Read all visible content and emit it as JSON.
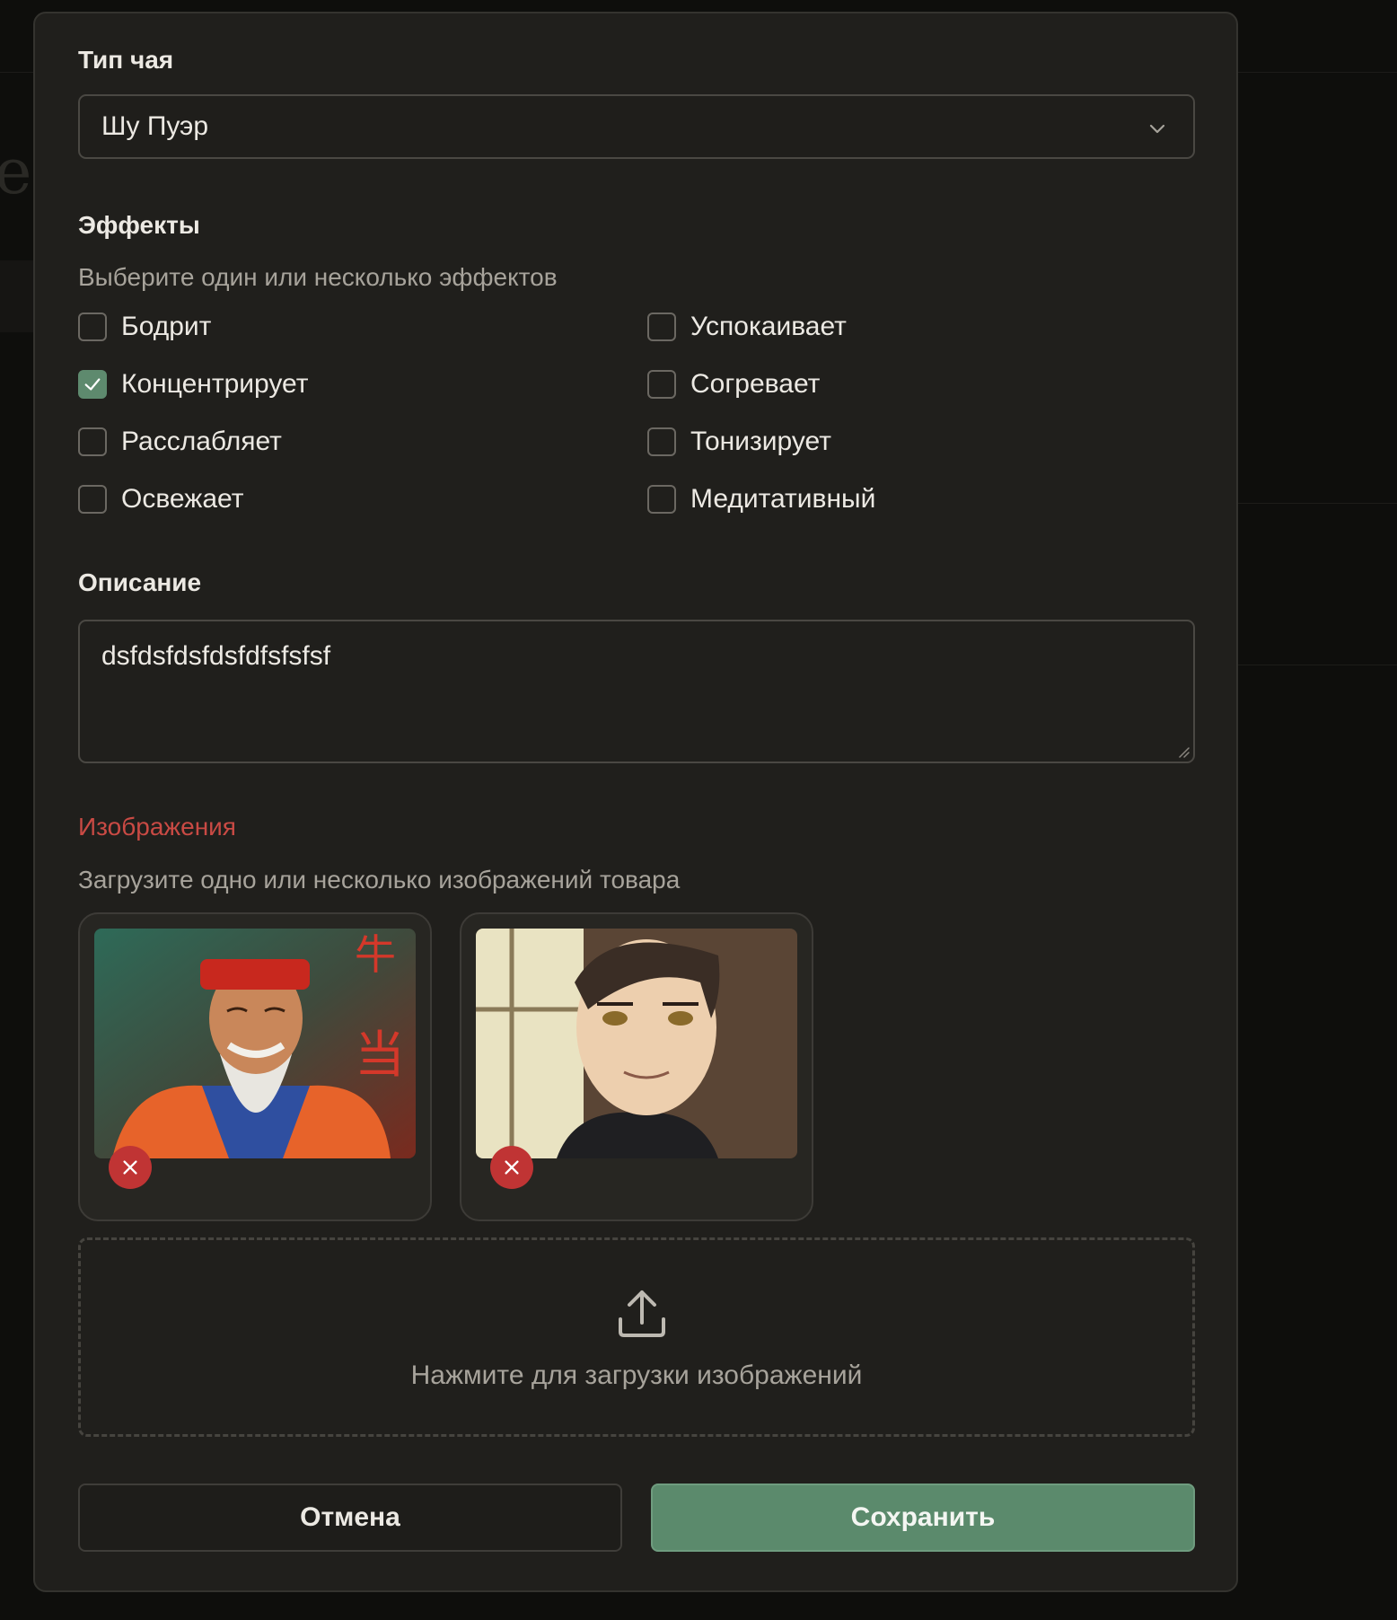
{
  "form": {
    "tea_type": {
      "label": "Тип чая",
      "selected": "Шу Пуэр"
    },
    "effects": {
      "label": "Эффекты",
      "hint": "Выберите один или несколько эффектов",
      "options": [
        {
          "label": "Бодрит",
          "checked": false
        },
        {
          "label": "Успокаивает",
          "checked": false
        },
        {
          "label": "Концентрирует",
          "checked": true
        },
        {
          "label": "Согревает",
          "checked": false
        },
        {
          "label": "Расслабляет",
          "checked": false
        },
        {
          "label": "Тонизирует",
          "checked": false
        },
        {
          "label": "Освежает",
          "checked": false
        },
        {
          "label": "Медитативный",
          "checked": false
        }
      ]
    },
    "description": {
      "label": "Описание",
      "value": "dsfdsfdsfdsfdfsfsfsf"
    },
    "images": {
      "label": "Изображения",
      "hint": "Загрузите одно или несколько изображений товара",
      "items": [
        {
          "subject": "elderly man with white beard and red hat"
        },
        {
          "subject": "anime-style young man portrait"
        }
      ],
      "upload_text": "Нажмите для загрузки изображений"
    },
    "actions": {
      "cancel": "Отмена",
      "save": "Сохранить"
    }
  },
  "colors": {
    "accent": "#5b8a6c",
    "error": "#c94a44",
    "remove": "#c03434"
  }
}
